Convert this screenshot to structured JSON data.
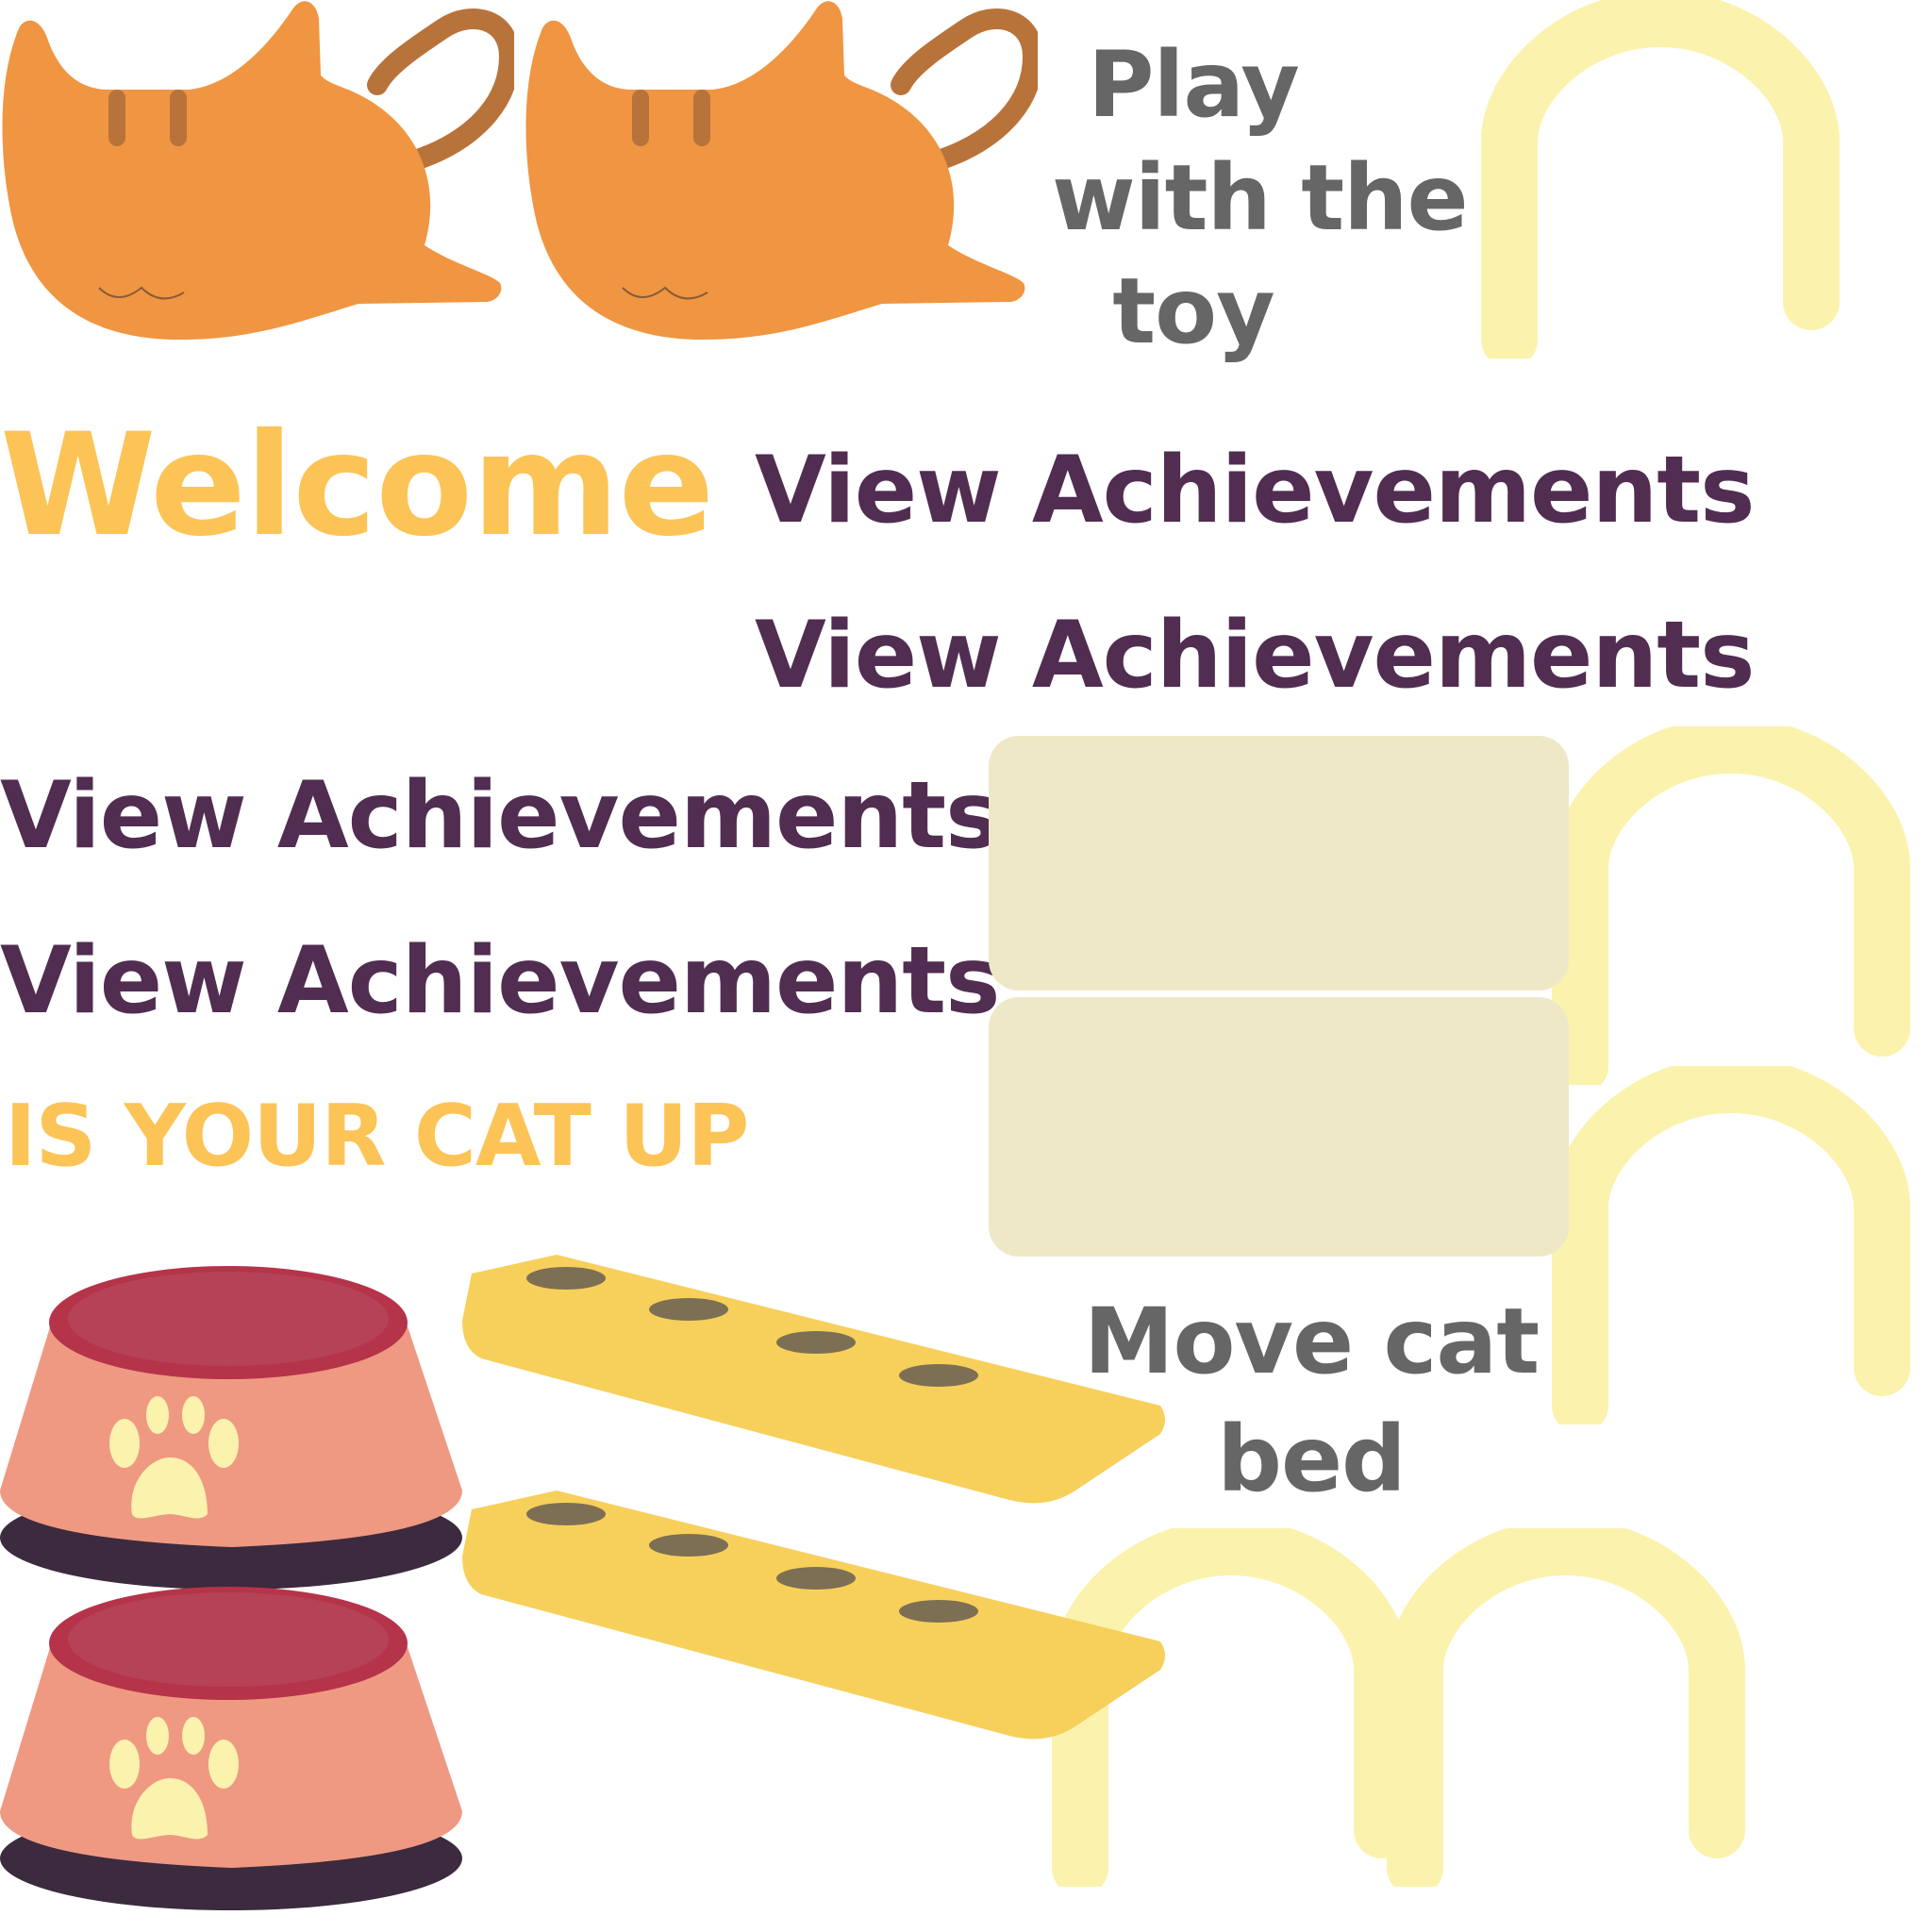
{
  "labels": {
    "play_toy": "Play with the toy",
    "play_toy_lines": [
      "Play",
      "with the",
      "toy"
    ],
    "welcome": "Welcome",
    "view_achievements": [
      "View Achievements",
      "View Achievements",
      "View Achievements",
      "View Achievements"
    ],
    "is_your_cat_up": "IS YOUR CAT UP",
    "move_cat_bed_lines": [
      "Move cat",
      "bed"
    ]
  },
  "sprites": {
    "cats": [
      "cat-sprite",
      "cat-sprite"
    ],
    "arches": [
      "arch-sprite",
      "arch-sprite",
      "arch-sprite",
      "arch-sprite",
      "arch-sprite"
    ],
    "bowls": [
      "food-bowl",
      "food-bowl"
    ],
    "boards": [
      "toy-board",
      "toy-board"
    ],
    "panels": [
      "panel",
      "panel"
    ]
  },
  "colors": {
    "cat_orange": "#f09541",
    "cat_stripe": "#b8733b",
    "arch_yellow": "#fbf3ad",
    "panel_beige": "#efe8c7",
    "text_grey": "#666666",
    "text_purple": "#512d52",
    "text_yellow": "#fcc457",
    "bowl_pink": "#ef9982",
    "bowl_red": "#b54256",
    "board_yellow": "#f6d05a",
    "hole_brown": "#7d6f54"
  }
}
